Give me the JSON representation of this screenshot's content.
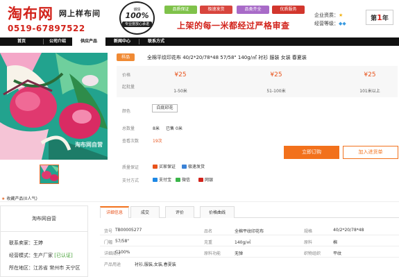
{
  "header": {
    "logo": "淘布网",
    "slogan": "网上样布间",
    "phone": "0519-67897522",
    "seal_top": "诚信",
    "seal_value": "100%",
    "seal_bottom": "专业度放心承诺",
    "badges": [
      "品质保证",
      "极速发货",
      "品类齐全",
      "优质服务"
    ],
    "motto": "上架的每一米都经过严格审查",
    "enterprise_label": "企业资质：",
    "rating_label": "经营等级：",
    "year_prefix": "第",
    "year_value": "1",
    "year_suffix": "年"
  },
  "nav": {
    "items": [
      {
        "label": "首页"
      },
      {
        "label": "公司介绍"
      },
      {
        "label": "供应产品"
      },
      {
        "label": "新闻中心"
      },
      {
        "label": "联系方式"
      }
    ]
  },
  "gallery": {
    "watermark": "淘布网自营",
    "favorite": "收藏产品(0人气)"
  },
  "product": {
    "tag": "样品",
    "title": "全棉平纹印花布 40/2*20/78*48 57/58\" 140g/㎡ 衬衫 服装 女装 春夏装",
    "price_label": "价格",
    "moq_label": "起批量",
    "prices": [
      "¥25",
      "¥25",
      "¥25"
    ],
    "ranges": [
      "1-50米",
      "51-100米",
      "101米以上"
    ],
    "color_label": "颜色",
    "color_value": "白底印花",
    "stock_label": "总数量",
    "stock_value": "8米",
    "sold_label": "已售",
    "sold_value": "0米",
    "views_label": "查看次数",
    "views_value": "19次",
    "buy_button": "立即订购",
    "cart_button": "加入进货单",
    "quality_label": "质量保证",
    "quality_items": [
      "买家保证",
      "极速发货"
    ],
    "payment_label": "支付方式",
    "payment_items": [
      "支付宝",
      "微信",
      "网银"
    ]
  },
  "seller": {
    "name": "淘布网自营",
    "contact_label": "联系卖家：",
    "contact_value": "王婷",
    "mode_label": "经营模式：",
    "mode_value": "生产厂家",
    "mode_verified": "[已认证]",
    "location_label": "所在地区：",
    "location_value": "江苏省 常州市 天宁区"
  },
  "tabs": [
    "详细信息",
    "成交",
    "评价",
    "价格曲线"
  ],
  "specs": [
    {
      "key": "货号",
      "value": "TB00005277"
    },
    {
      "key": "品名",
      "value": "全棉平纹印花布"
    },
    {
      "key": "规格",
      "value": "40/2*20/78*48"
    },
    {
      "key": "门幅",
      "value": "57/58\""
    },
    {
      "key": "克重",
      "value": "140g/㎡"
    },
    {
      "key": "原料",
      "value": "棉"
    },
    {
      "key": "详细成分",
      "value": "C100%"
    },
    {
      "key": "原料功能",
      "value": "无弹"
    },
    {
      "key": "织物组织",
      "value": "平纹"
    },
    {
      "key": "产品用途",
      "value": "衬衫,服装,女装,春夏装"
    }
  ],
  "colors": {
    "brand_red": "#d2231b",
    "accent_orange": "#f2711c",
    "price_orange": "#e8531b",
    "nav_black": "#111111"
  }
}
